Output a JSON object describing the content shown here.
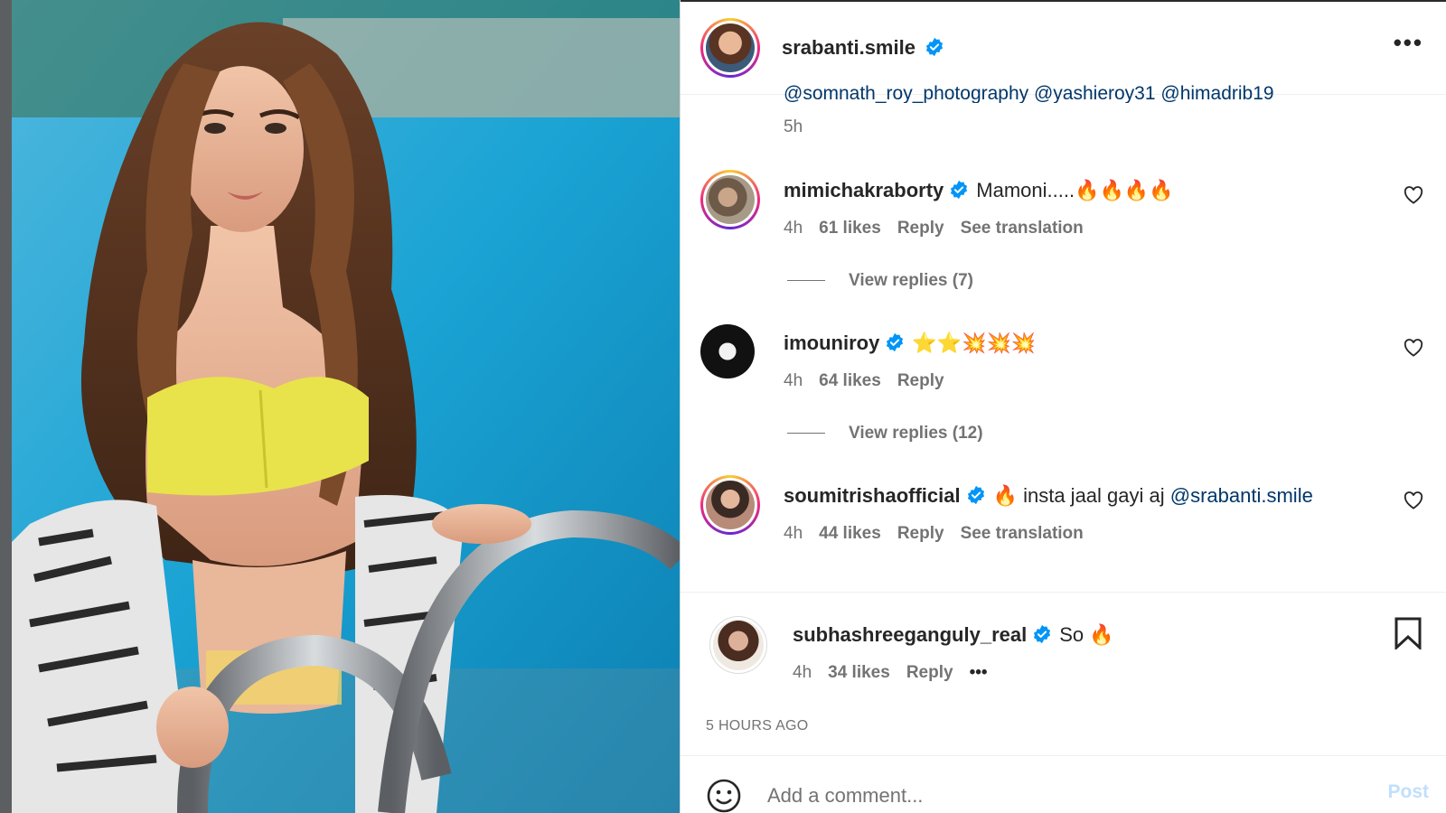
{
  "post": {
    "author": "srabanti.smile",
    "caption_tags": "@somnath_roy_photography @yashieroy31 @himadrib19",
    "caption_time": "5h",
    "timestamp": "5 HOURS AGO"
  },
  "comments": [
    {
      "user": "mimichakraborty",
      "text": "Mamoni.....🔥🔥🔥🔥",
      "time": "4h",
      "likes": "61 likes",
      "reply": "Reply",
      "translate": "See translation",
      "view_replies": "View replies (7)"
    },
    {
      "user": "imouniroy",
      "text": "⭐⭐💥💥💥",
      "time": "4h",
      "likes": "64 likes",
      "reply": "Reply",
      "view_replies": "View replies (12)"
    },
    {
      "user": "soumitrishaofficial",
      "text": "🔥 insta jaal gayi aj",
      "mention": "@srabanti.smile",
      "time": "4h",
      "likes": "44 likes",
      "reply": "Reply",
      "translate": "See translation"
    },
    {
      "user": "subhashreeganguly_real",
      "text": "So 🔥",
      "time": "4h",
      "likes": "34 likes",
      "reply": "Reply",
      "more": "•••"
    }
  ],
  "composer": {
    "placeholder": "Add a comment...",
    "post_label": "Post"
  },
  "icons": {
    "verified": "verified-badge-icon",
    "heart": "heart-icon",
    "bookmark": "bookmark-icon",
    "emoji": "emoji-icon",
    "more": "more-options-icon"
  },
  "colors": {
    "verified": "#0095f6",
    "link": "#00376b",
    "muted": "#737373",
    "post_disabled": "#c0dffd"
  }
}
